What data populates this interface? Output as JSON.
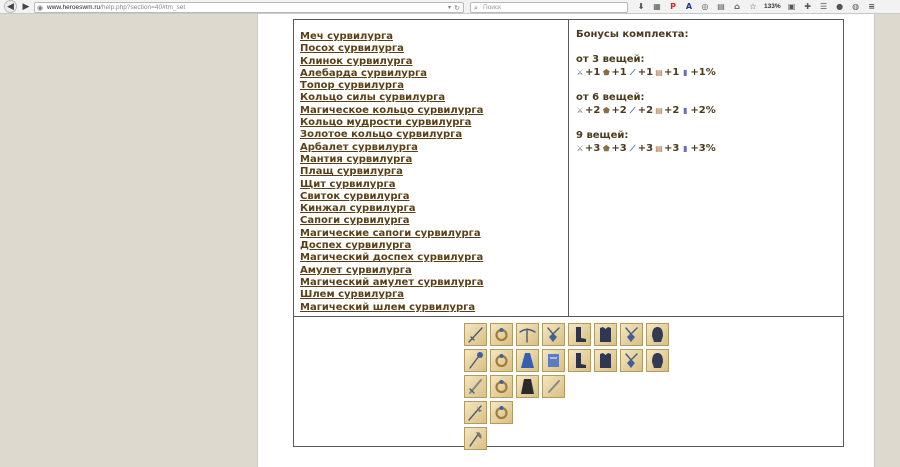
{
  "browser": {
    "url_domain": "www.heroeswm.ru",
    "url_path": "/help.php?section=40#tm_set",
    "search_placeholder": "Поиск",
    "zoom": "133%"
  },
  "set": {
    "items": [
      "Меч сурвилурга",
      "Посох сурвилурга",
      "Клинок сурвилурга",
      "Алебарда сурвилурга",
      "Топор сурвилурга",
      "Кольцо силы сурвилурга",
      "Магическое кольцо сурвилурга",
      "Кольцо мудрости сурвилурга",
      "Золотое кольцо сурвилурга",
      "Арбалет сурвилурга",
      "Мантия сурвилурга",
      "Плащ сурвилурга",
      "Щит сурвилурга",
      "Свиток сурвилурга",
      "Кинжал сурвилурга",
      "Сапоги сурвилурга",
      "Магические сапоги сурвилурга",
      "Доспех сурвилурга",
      "Магический доспех сурвилурга",
      "Амулет сурвилурга",
      "Магический амулет сурвилурга",
      "Шлем сурвилурга",
      "Магический шлем сурвилурга"
    ],
    "bonus_title": "Бонусы комплекта:",
    "tiers": [
      {
        "heading": "от 3 вещей:",
        "values": [
          "+1",
          "+1",
          "+1",
          "+1",
          "+1%"
        ]
      },
      {
        "heading": "от 6 вещей:",
        "values": [
          "+2",
          "+2",
          "+2",
          "+2",
          "+2%"
        ]
      },
      {
        "heading": "9 вещей:",
        "values": [
          "+3",
          "+3",
          "+3",
          "+3",
          "+3%"
        ]
      }
    ],
    "stat_icons": [
      "sword-icon",
      "shield-icon",
      "wand-icon",
      "scroll-icon",
      "gem-icon"
    ],
    "grid_icons": [
      [
        "sword-icon",
        "ring-icon",
        "crossbow-icon",
        "amulet-icon",
        "boots-icon",
        "armor-icon",
        "amulet-icon",
        "helmet-icon"
      ],
      [
        "staff-icon",
        "ring-icon",
        "robe-icon",
        "scroll-icon",
        "boots-icon",
        "armor-icon",
        "amulet-icon",
        "helmet-icon"
      ],
      [
        "blade-icon",
        "ring-icon",
        "cloak-icon",
        "dagger-icon"
      ],
      [
        "halberd-icon",
        "ring-icon"
      ],
      [
        "axe-icon"
      ]
    ]
  }
}
